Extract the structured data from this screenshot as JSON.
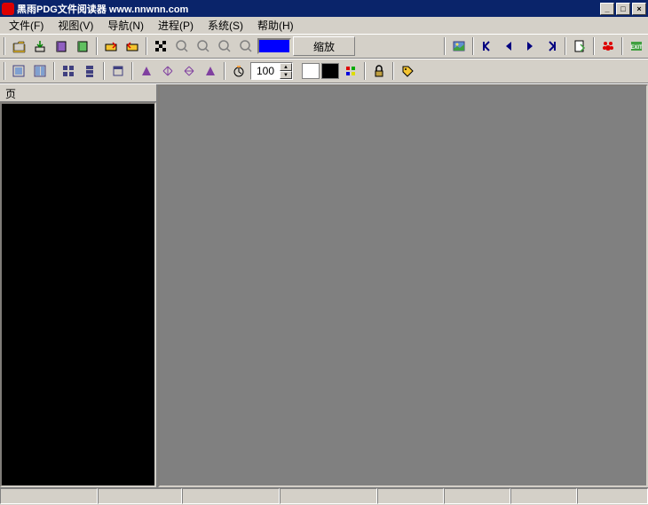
{
  "title": "黑雨PDG文件阅读器 www.nnwnn.com",
  "menu": {
    "file": "文件(F)",
    "view": "视图(V)",
    "nav": "导航(N)",
    "process": "进程(P)",
    "system": "系统(S)",
    "help": "帮助(H)"
  },
  "toolbar1": {
    "zoom_label": "缩放",
    "selected_color": "#0000ff"
  },
  "toolbar2": {
    "zoom_value": "100",
    "fg_color": "#ffffff",
    "bg_color": "#000000"
  },
  "sidepanel": {
    "tab_label": "页"
  },
  "statusbar": {
    "cells": [
      "",
      "",
      "",
      "",
      "",
      "",
      "",
      ""
    ]
  }
}
